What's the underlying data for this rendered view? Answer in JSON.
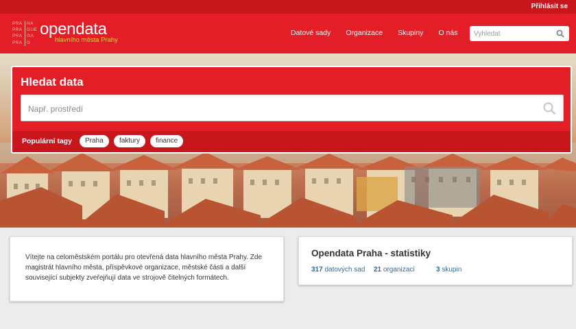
{
  "topbar": {
    "login_label": "Přihlásit se"
  },
  "logo": {
    "grid": [
      [
        "PRA",
        "HA"
      ],
      [
        "PRA",
        "GUE"
      ],
      [
        "PRA",
        "GA"
      ],
      [
        "PRA",
        "G"
      ]
    ],
    "wordmark": "opendata",
    "subtitle": "hlavního města Prahy"
  },
  "nav": {
    "items": [
      "Datové sady",
      "Organizace",
      "Skupiny",
      "O nás"
    ]
  },
  "header_search": {
    "placeholder": "Vyhledat",
    "icon": "search-icon"
  },
  "hero_search": {
    "title": "Hledat data",
    "placeholder": "Např. prostředí",
    "icon": "search-icon",
    "popular_tags_label": "Populární tagy",
    "tags": [
      "Praha",
      "faktury",
      "finance"
    ]
  },
  "welcome": {
    "text": "Vítejte na celoměstském portálu pro otevřená data hlavního města Prahy. Zde magistrát hlavního města, příspěvkové organizace, městské části a další související subjekty zveřejňují data ve strojově čitelných formátech."
  },
  "stats": {
    "title": "Opendata Praha - statistiky",
    "items": [
      {
        "count": "317",
        "label": "datových sad"
      },
      {
        "count": "21",
        "label": "organizací"
      },
      {
        "count": "3",
        "label": "skupin"
      }
    ]
  },
  "colors": {
    "brand_red": "#e41e26",
    "dark_red": "#c8161d",
    "link_blue": "#2d6a9f",
    "logo_yellow": "#f8c94e"
  }
}
